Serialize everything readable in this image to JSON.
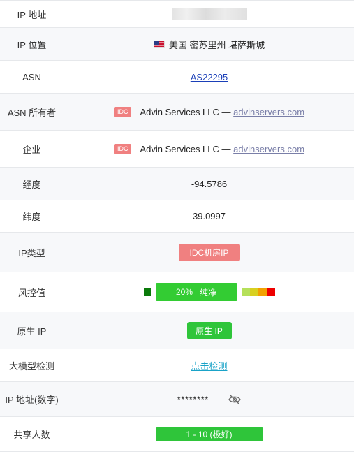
{
  "rows": [
    {
      "label": "IP 地址"
    },
    {
      "label": "IP 位置",
      "value": "美国 密苏里州 堪萨斯城",
      "icon": "us-flag-icon"
    },
    {
      "label": "ASN",
      "value": "AS22295"
    },
    {
      "label": "ASN 所有者",
      "tag": "IDC",
      "company": "Advin Services LLC —",
      "link": "advinservers.com"
    },
    {
      "label": "企业",
      "tag": "IDC",
      "company": "Advin Services LLC —",
      "link": "advinservers.com"
    },
    {
      "label": "经度",
      "value": "-94.5786"
    },
    {
      "label": "纬度",
      "value": "39.0997"
    },
    {
      "label": "IP类型",
      "value": "IDC机房IP"
    },
    {
      "label": "风控值",
      "percent": "20%",
      "status": "纯净",
      "score_fraction": 0.2
    },
    {
      "label": "原生 IP",
      "value": "原生 IP"
    },
    {
      "label": "大模型检测",
      "value": "点击检测"
    },
    {
      "label": "IP 地址(数字)",
      "value": "********",
      "icon": "eye-off-icon"
    },
    {
      "label": "共享人数",
      "value": "1 - 10 (极好)"
    }
  ],
  "colors": {
    "idc_red": "#f08080",
    "green": "#2fc53a",
    "dark_green": "#0b7a0b",
    "scale": [
      "#b5e05a",
      "#d8d020",
      "#f2a100",
      "#ee0000"
    ]
  }
}
